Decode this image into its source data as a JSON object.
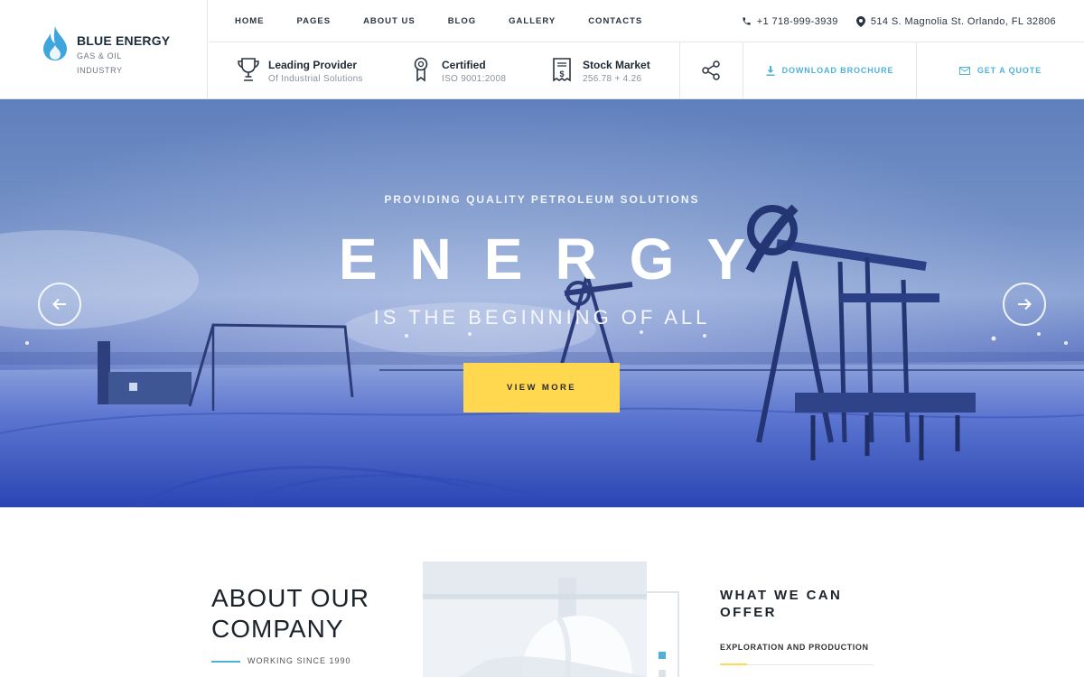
{
  "brand": {
    "name": "BLUE ENERGY",
    "tagline_line1": "GAS & OIL",
    "tagline_line2": "INDUSTRY",
    "logo_icon": "flame-icon",
    "accent_color": "#4fb1d9"
  },
  "nav": {
    "items": [
      {
        "label": "HOME"
      },
      {
        "label": "PAGES"
      },
      {
        "label": "ABOUT US"
      },
      {
        "label": "BLOG"
      },
      {
        "label": "GALLERY"
      },
      {
        "label": "CONTACTS"
      }
    ]
  },
  "contact": {
    "phone": "+1 718-999-3939",
    "phone_icon": "phone-icon",
    "address": "514 S. Magnolia St. Orlando, FL 32806",
    "address_icon": "location-pin-icon"
  },
  "info": {
    "provider": {
      "title": "Leading Provider",
      "subtitle": "Of Industrial Solutions",
      "icon": "trophy-icon"
    },
    "certified": {
      "title": "Certified",
      "subtitle": "ISO 9001:2008",
      "icon": "award-ribbon-icon"
    },
    "stock": {
      "title": "Stock Market",
      "subtitle": "256.78 + 4.26",
      "icon": "receipt-dollar-icon"
    }
  },
  "actions": {
    "share_icon": "share-icon",
    "download_label": "DOWNLOAD BROCHURE",
    "download_icon": "download-icon",
    "quote_label": "GET A QUOTE",
    "quote_icon": "envelope-icon"
  },
  "hero": {
    "kicker": "PROVIDING QUALITY PETROLEUM SOLUTIONS",
    "headline": "ENERGY",
    "subline": "IS THE BEGINNING OF ALL",
    "cta_label": "VIEW MORE",
    "cta_color": "#ffd84f",
    "prev_icon": "arrow-left-icon",
    "next_icon": "arrow-right-icon"
  },
  "about": {
    "title_line1": "ABOUT OUR",
    "title_line2": "COMPANY",
    "since": "WORKING SINCE 1990"
  },
  "offer": {
    "title_line1": "WHAT WE CAN",
    "title_line2": "OFFER",
    "first_item": "EXPLORATION AND PRODUCTION"
  }
}
